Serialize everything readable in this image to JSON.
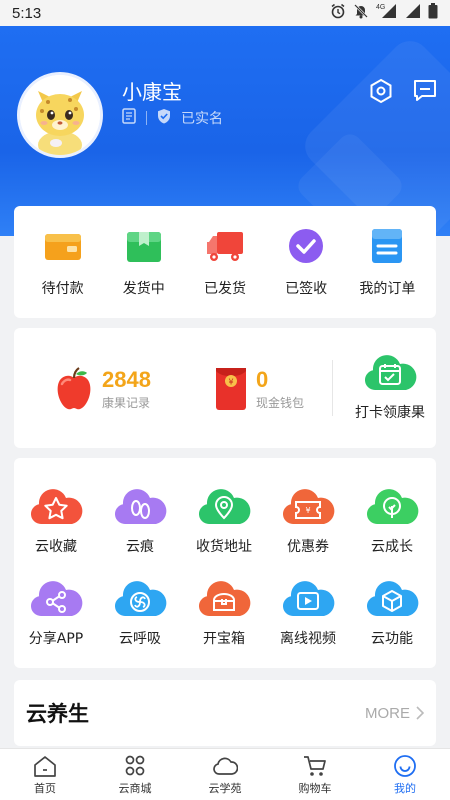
{
  "status_bar": {
    "time": "5:13",
    "network": "4G"
  },
  "profile": {
    "name": "小康宝",
    "verified_label": "已实名"
  },
  "header_icons": [
    "settings-icon",
    "message-icon"
  ],
  "orders": [
    {
      "label": "待付款",
      "icon": "wallet-icon",
      "color": "#f5a11c"
    },
    {
      "label": "发货中",
      "icon": "package-icon",
      "color": "#2fbf5a"
    },
    {
      "label": "已发货",
      "icon": "truck-icon",
      "color": "#f0453a"
    },
    {
      "label": "已签收",
      "icon": "check-circle-icon",
      "color": "#8c5cf0"
    },
    {
      "label": "我的订单",
      "icon": "order-list-icon",
      "color": "#2b96f3"
    }
  ],
  "points": {
    "apple_value": "2848",
    "apple_label": "康果记录",
    "cash_value": "0",
    "cash_label": "现金钱包",
    "checkin_label": "打卡领康果"
  },
  "services": [
    {
      "label": "云收藏",
      "icon": "star-cloud-icon",
      "color": "#f3533c"
    },
    {
      "label": "云痕",
      "icon": "footprint-cloud-icon",
      "color": "#a77af2"
    },
    {
      "label": "收货地址",
      "icon": "location-cloud-icon",
      "color": "#2cc46a"
    },
    {
      "label": "优惠券",
      "icon": "coupon-cloud-icon",
      "color": "#f0663a"
    },
    {
      "label": "云成长",
      "icon": "tree-cloud-icon",
      "color": "#3ccf62"
    },
    {
      "label": "分享APP",
      "icon": "share-cloud-icon",
      "color": "#a77af2"
    },
    {
      "label": "云呼吸",
      "icon": "fan-cloud-icon",
      "color": "#2ea6f2"
    },
    {
      "label": "开宝箱",
      "icon": "treasure-cloud-icon",
      "color": "#f0663a"
    },
    {
      "label": "离线视频",
      "icon": "video-cloud-icon",
      "color": "#2ea6f2"
    },
    {
      "label": "云功能",
      "icon": "cube-cloud-icon",
      "color": "#2ea6f2"
    }
  ],
  "health": {
    "title": "云养生",
    "more": "MORE"
  },
  "bottom_nav": [
    {
      "label": "首页",
      "icon": "home-icon"
    },
    {
      "label": "云商城",
      "icon": "mall-icon"
    },
    {
      "label": "云学苑",
      "icon": "cloud-icon"
    },
    {
      "label": "购物车",
      "icon": "cart-icon"
    },
    {
      "label": "我的",
      "icon": "profile-icon",
      "active": true
    }
  ]
}
